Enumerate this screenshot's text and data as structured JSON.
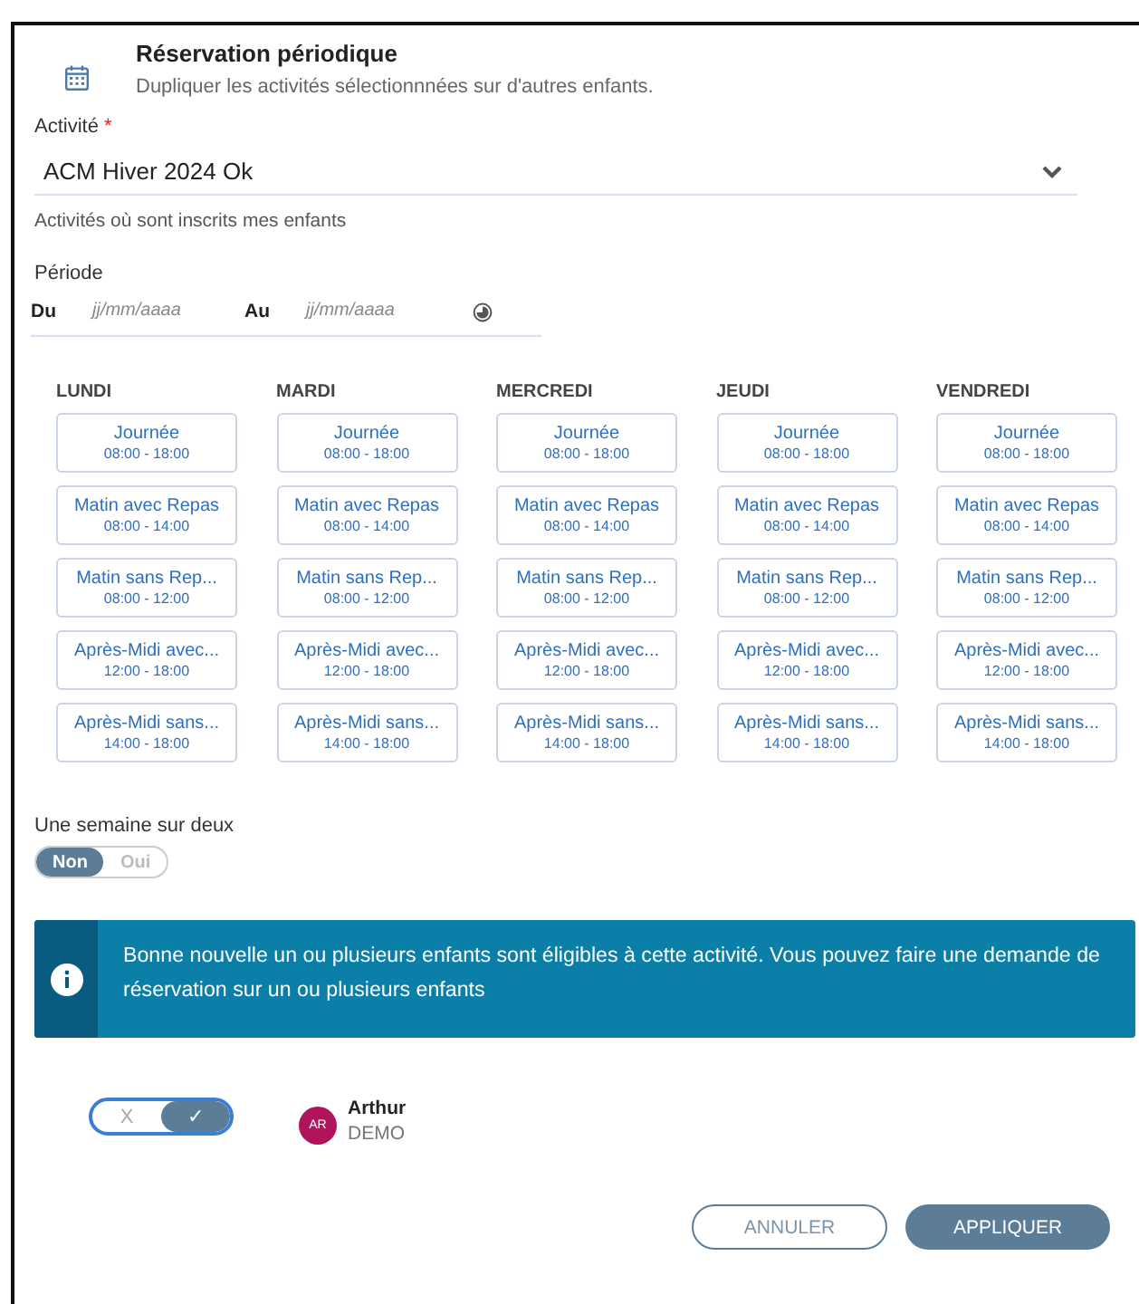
{
  "header": {
    "title": "Réservation périodique",
    "subtitle": "Dupliquer les activités sélectionnnées sur d'autres enfants."
  },
  "activity": {
    "label": "Activité",
    "required_mark": "*",
    "value": "ACM Hiver 2024 Ok",
    "hint": "Activités où sont inscrits mes enfants"
  },
  "period": {
    "label": "Période",
    "from_label": "Du",
    "from_placeholder": "jj/mm/aaaa",
    "to_label": "Au",
    "to_placeholder": "jj/mm/aaaa"
  },
  "days": [
    {
      "label": "LUNDI",
      "slots": [
        {
          "name": "Journée",
          "time": "08:00 - 18:00"
        },
        {
          "name": "Matin avec Repas",
          "time": "08:00 - 14:00"
        },
        {
          "name": "Matin sans Rep...",
          "time": "08:00 - 12:00"
        },
        {
          "name": "Après-Midi avec...",
          "time": "12:00 - 18:00"
        },
        {
          "name": "Après-Midi sans...",
          "time": "14:00 - 18:00"
        }
      ]
    },
    {
      "label": "MARDI",
      "slots": [
        {
          "name": "Journée",
          "time": "08:00 - 18:00"
        },
        {
          "name": "Matin avec Repas",
          "time": "08:00 - 14:00"
        },
        {
          "name": "Matin sans Rep...",
          "time": "08:00 - 12:00"
        },
        {
          "name": "Après-Midi avec...",
          "time": "12:00 - 18:00"
        },
        {
          "name": "Après-Midi sans...",
          "time": "14:00 - 18:00"
        }
      ]
    },
    {
      "label": "MERCREDI",
      "slots": [
        {
          "name": "Journée",
          "time": "08:00 - 18:00"
        },
        {
          "name": "Matin avec Repas",
          "time": "08:00 - 14:00"
        },
        {
          "name": "Matin sans Rep...",
          "time": "08:00 - 12:00"
        },
        {
          "name": "Après-Midi avec...",
          "time": "12:00 - 18:00"
        },
        {
          "name": "Après-Midi sans...",
          "time": "14:00 - 18:00"
        }
      ]
    },
    {
      "label": "JEUDI",
      "slots": [
        {
          "name": "Journée",
          "time": "08:00 - 18:00"
        },
        {
          "name": "Matin avec Repas",
          "time": "08:00 - 14:00"
        },
        {
          "name": "Matin sans Rep...",
          "time": "08:00 - 12:00"
        },
        {
          "name": "Après-Midi avec...",
          "time": "12:00 - 18:00"
        },
        {
          "name": "Après-Midi sans...",
          "time": "14:00 - 18:00"
        }
      ]
    },
    {
      "label": "VENDREDI",
      "slots": [
        {
          "name": "Journée",
          "time": "08:00 - 18:00"
        },
        {
          "name": "Matin avec Repas",
          "time": "08:00 - 14:00"
        },
        {
          "name": "Matin sans Rep...",
          "time": "08:00 - 12:00"
        },
        {
          "name": "Après-Midi avec...",
          "time": "12:00 - 18:00"
        },
        {
          "name": "Après-Midi sans...",
          "time": "14:00 - 18:00"
        }
      ]
    }
  ],
  "alternate_weeks": {
    "label": "Une semaine sur deux",
    "options": [
      {
        "label": "Non",
        "selected": true
      },
      {
        "label": "Oui",
        "selected": false
      }
    ]
  },
  "info_banner": {
    "text": "Bonne nouvelle un ou plusieurs enfants sont éligibles à cette activité. Vous pouvez faire une demande de réservation sur un ou plusieurs enfants"
  },
  "children": [
    {
      "off_label": "X",
      "on_label": "✓",
      "on": true,
      "initials": "AR",
      "first_name": "Arthur",
      "last_name": "DEMO"
    }
  ],
  "buttons": [
    {
      "label": "ANNULER",
      "kind": "secondary"
    },
    {
      "label": "APPLIQUER",
      "kind": "primary"
    }
  ]
}
